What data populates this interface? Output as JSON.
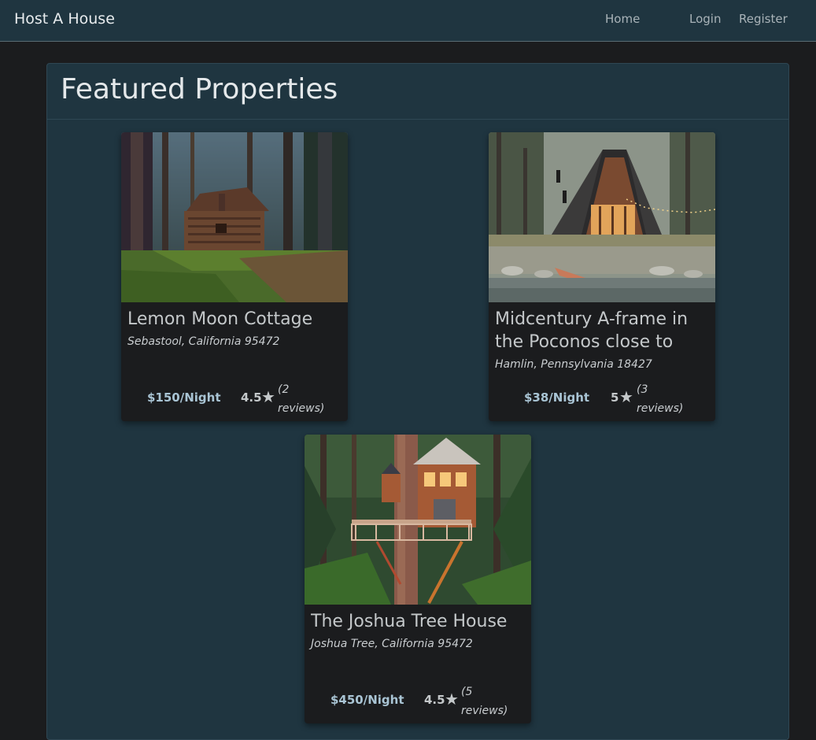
{
  "navbar": {
    "brand": "Host A House",
    "links": [
      "Home",
      "Login",
      "Register"
    ]
  },
  "main": {
    "title": "Featured Properties"
  },
  "properties": [
    {
      "title": "Lemon Moon Cottage",
      "location": "Sebastool, California 95472",
      "price": "$150/Night",
      "rating": "4.5",
      "reviews_open": "(2",
      "reviews_close": "reviews)",
      "image": "forest-log-cabin"
    },
    {
      "title": "Midcentury A-frame in the Poconos close to",
      "location": "Hamlin, Pennsylvania 18427",
      "price": "$38/Night",
      "rating": "5",
      "reviews_open": "(3",
      "reviews_close": "reviews)",
      "image": "lakeside-a-frame"
    },
    {
      "title": "The Joshua Tree House",
      "location": "Joshua Tree, California 95472",
      "price": "$450/Night",
      "rating": "4.5",
      "reviews_open": "(5",
      "reviews_close": "reviews)",
      "image": "treehouse"
    }
  ],
  "icons": {
    "rating": "star-icon"
  },
  "colors": {
    "navbar_bg": "#1f3540",
    "page_bg": "#1b1c1e",
    "panel_bg": "#1f3540",
    "card_bg": "#1b1c1e",
    "price": "#a9c4d4"
  }
}
